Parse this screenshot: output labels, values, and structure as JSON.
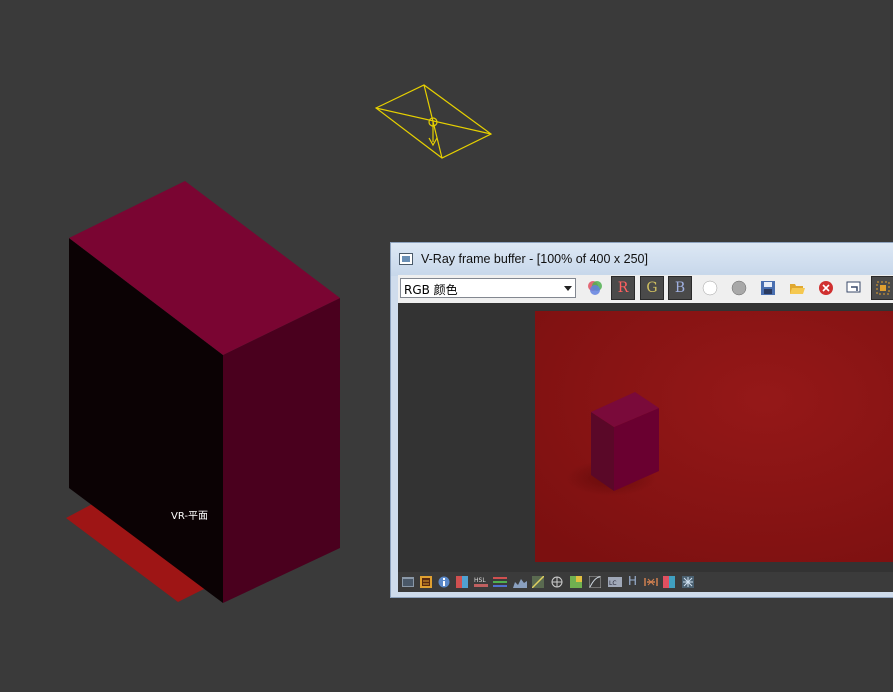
{
  "viewport": {
    "object_label": "VR-平面",
    "colors": {
      "background": "#3a3a3a",
      "box_top": "#7a0532",
      "box_right": "#4a001e",
      "box_left": "#0b0204",
      "plane": "#9e1515",
      "camera": "#e6d000"
    }
  },
  "frame_buffer": {
    "title": "V-Ray frame buffer - [100% of 400 x 250]",
    "channel_select": {
      "value": "RGB 颜色"
    },
    "channel_buttons": {
      "r": "R",
      "g": "G",
      "b": "B"
    },
    "toolbar_icons": [
      "channels-icon",
      "white-circle-icon",
      "gray-circle-icon",
      "save-icon",
      "open-folder-icon",
      "clear-icon",
      "duplicate-icon",
      "region-icon"
    ],
    "status_icons": [
      "panel-icon",
      "history-icon",
      "info-icon",
      "color-corrections-icon",
      "hsl-icon",
      "levels-icon",
      "histogram-icon",
      "curve-icon",
      "exposure-icon",
      "lut-icon",
      "curve2-icon",
      "lens-icon",
      "hdr-icon",
      "hue-icon",
      "white-balance-icon",
      "compare-icon",
      "star-icon"
    ],
    "status_h_label": "H",
    "render_colors": {
      "background": "#8a1414",
      "box_top": "#7a0a3a",
      "box_side": "#6a0030"
    }
  }
}
